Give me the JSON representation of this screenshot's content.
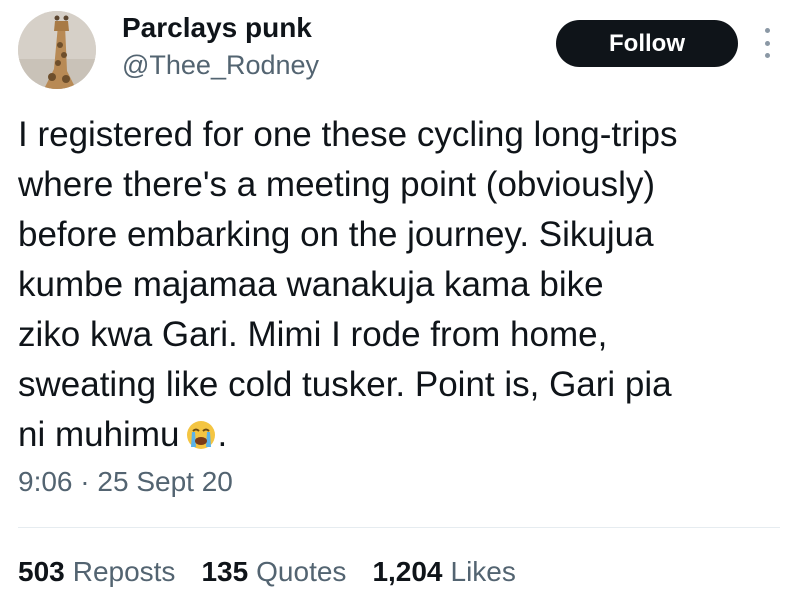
{
  "author": {
    "display_name": "Parclays punk",
    "handle": "@Thee_Rodney"
  },
  "follow_button": {
    "label": "Follow"
  },
  "tweet": {
    "lines": [
      "I registered for one these cycling long-trips",
      "where there's a meeting point (obviously)",
      "before embarking on the journey. Sikujua",
      "kumbe majamaa wanakuja kama bike",
      "ziko kwa Gari. Mimi I rode from home,",
      "sweating like cold tusker. Point is, Gari pia",
      "ni muhimu"
    ],
    "trailing_emoji": "loudly-crying-face-emoji",
    "trailing_punct": "."
  },
  "meta": {
    "time": "9:06",
    "separator": "·",
    "date": "25 Sept 20"
  },
  "stats": {
    "reposts_count": "503",
    "reposts_label": "Reposts",
    "quotes_count": "135",
    "quotes_label": "Quotes",
    "likes_count": "1,204",
    "likes_label": "Likes"
  },
  "icons": {
    "more": "more-vertical-icon",
    "avatar": "giraffe-avatar"
  },
  "colors": {
    "text": "#0f1419",
    "secondary": "#536471",
    "follow_bg": "#0f1419",
    "divider": "#e6ecf0"
  }
}
